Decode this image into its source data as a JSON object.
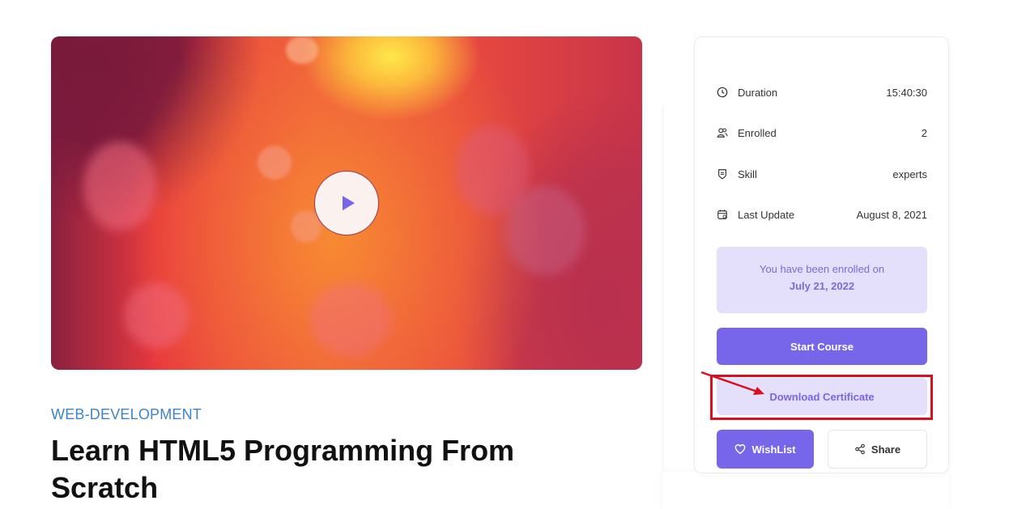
{
  "video": {
    "play_icon": "play-icon",
    "play_color": "#7866ea"
  },
  "course": {
    "category": "WEB-DEVELOPMENT",
    "title": "Learn HTML5 Programming From Scratch"
  },
  "sidebar": {
    "meta": [
      {
        "icon": "clock-icon",
        "label": "Duration",
        "value": "15:40:30"
      },
      {
        "icon": "users-icon",
        "label": "Enrolled",
        "value": "2"
      },
      {
        "icon": "shield-icon",
        "label": "Skill",
        "value": "experts"
      },
      {
        "icon": "calendar-icon",
        "label": "Last Update",
        "value": "August 8, 2021"
      }
    ],
    "enrolled_notice": {
      "text": "You have been enrolled on",
      "date": "July 21, 2022"
    },
    "buttons": {
      "start": "Start Course",
      "certificate": "Download Certificate",
      "wishlist": "WishList",
      "share": "Share"
    }
  },
  "annotation": {
    "highlight_color": "#d81020",
    "target": "Download Certificate"
  },
  "colors": {
    "accent": "#7866ea",
    "accent_light": "#e4e0fb",
    "category": "#3d84c9"
  }
}
